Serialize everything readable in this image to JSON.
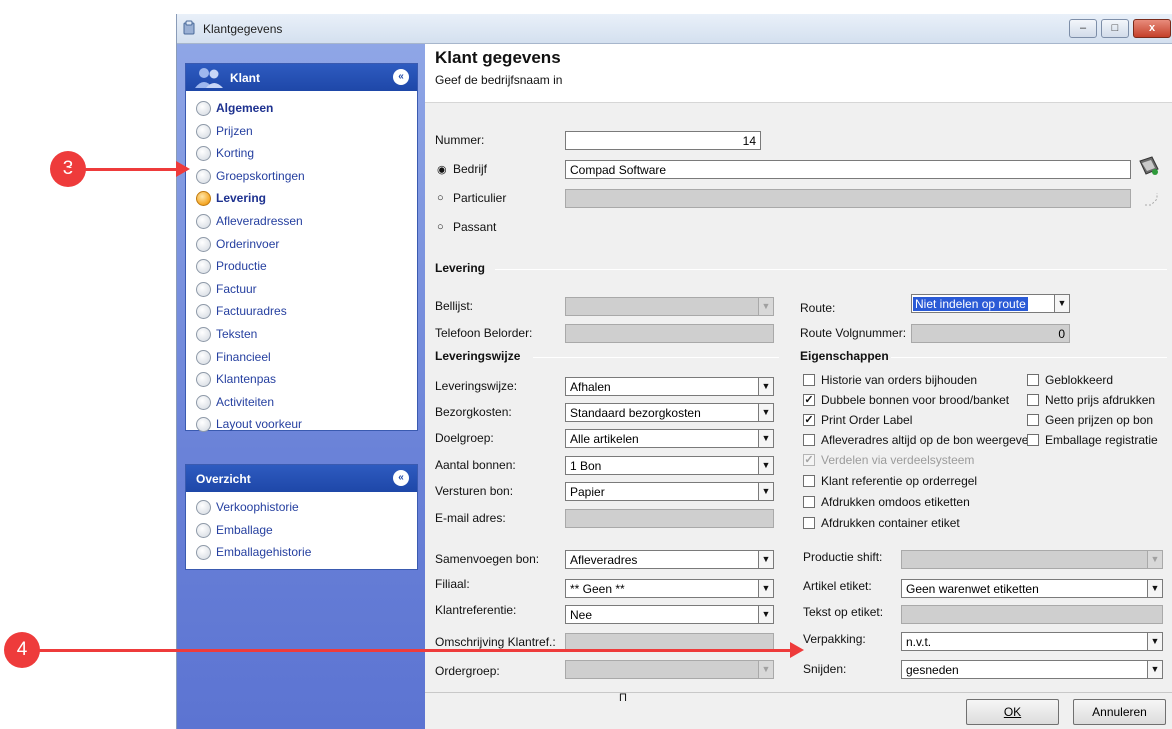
{
  "window": {
    "title": "Klantgegevens",
    "btn_minimize": "–",
    "btn_maximize": "□",
    "btn_close": "x"
  },
  "sidebar": {
    "klant": {
      "title": "Klant",
      "collapse": "«",
      "items": [
        "Algemeen",
        "Prijzen",
        "Korting",
        "Groepskortingen",
        "Levering",
        "Afleveradressen",
        "Orderinvoer",
        "Productie",
        "Factuur",
        "Factuuradres",
        "Teksten",
        "Financieel",
        "Klantenpas",
        "Activiteiten",
        "Layout voorkeur"
      ],
      "active": "Levering"
    },
    "overzicht": {
      "title": "Overzicht",
      "collapse": "«",
      "items": [
        "Verkoophistorie",
        "Emballage",
        "Emballagehistorie"
      ]
    }
  },
  "header": {
    "title": "Klant gegevens",
    "subtitle": "Geef de bedrijfsnaam in"
  },
  "form": {
    "nummer_label": "Nummer:",
    "nummer_value": "14",
    "bedrijf_label": "Bedrijf",
    "bedrijf_value": "Compad Software",
    "particulier_label": "Particulier",
    "passant_label": "Passant",
    "radio_selected": "◉",
    "radio_unselected": "○"
  },
  "levering": {
    "section": "Levering",
    "bellijst_label": "Bellijst:",
    "telefoon_label": "Telefoon Belorder:",
    "route_label": "Route:",
    "route_value": "Niet indelen op route",
    "route_volg_label": "Route Volgnummer:",
    "route_volg_value": "0"
  },
  "leveringswijze": {
    "section": "Leveringswijze",
    "fields": [
      {
        "label": "Leveringswijze:",
        "value": "Afhalen"
      },
      {
        "label": "Bezorgkosten:",
        "value": "Standaard bezorgkosten"
      },
      {
        "label": "Doelgroep:",
        "value": "Alle artikelen"
      },
      {
        "label": "Aantal bonnen:",
        "value": "1 Bon"
      },
      {
        "label": "Versturen bon:",
        "value": "Papier"
      }
    ],
    "email_label": "E-mail adres:",
    "samenvoegen_label": "Samenvoegen bon:",
    "samenvoegen_value": "Afleveradres",
    "filiaal_label": "Filiaal:",
    "filiaal_value": "** Geen **",
    "klantref_label": "Klantreferentie:",
    "klantref_value": "Nee",
    "omschrijving_label": "Omschrijving Klantref.:",
    "ordergroep_label": "Ordergroep:"
  },
  "eigenschappen": {
    "section": "Eigenschappen",
    "check_mark": "✓",
    "left": [
      {
        "label": "Historie van orders bijhouden",
        "checked": false,
        "disabled": false
      },
      {
        "label": "Dubbele bonnen voor brood/banket",
        "checked": true,
        "disabled": false
      },
      {
        "label": "Print Order Label",
        "checked": true,
        "disabled": false
      },
      {
        "label": "Afleveradres altijd op de bon weergeve",
        "checked": false,
        "disabled": false
      },
      {
        "label": "Verdelen via verdeelsysteem",
        "checked": true,
        "disabled": true
      },
      {
        "label": "Klant referentie op orderregel",
        "checked": false,
        "disabled": false
      },
      {
        "label": "Afdrukken omdoos etiketten",
        "checked": false,
        "disabled": false
      },
      {
        "label": "Afdrukken container etiket",
        "checked": false,
        "disabled": false
      }
    ],
    "right": [
      {
        "label": "Geblokkeerd",
        "checked": false
      },
      {
        "label": "Netto prijs afdrukken",
        "checked": false
      },
      {
        "label": "Geen prijzen op bon",
        "checked": false
      },
      {
        "label": "Emballage registratie",
        "checked": false
      }
    ],
    "productie_shift_label": "Productie shift:",
    "artikel_etiket_label": "Artikel etiket:",
    "artikel_etiket_value": "Geen warenwet etiketten",
    "tekst_etiket_label": "Tekst op etiket:",
    "verpakking_label": "Verpakking:",
    "verpakking_value": "n.v.t.",
    "snijden_label": "Snijden:",
    "snijden_value": "gesneden"
  },
  "footer": {
    "ok_label": "OK",
    "annuleren_label": "Annuleren",
    "marker": "Π"
  },
  "annotations": {
    "badge_3": "3",
    "badge_4": "4"
  },
  "colors": {
    "annotation": "#ee3b3b",
    "sidebar_header": "#1e47a8",
    "active_radio": "#f5a623"
  }
}
